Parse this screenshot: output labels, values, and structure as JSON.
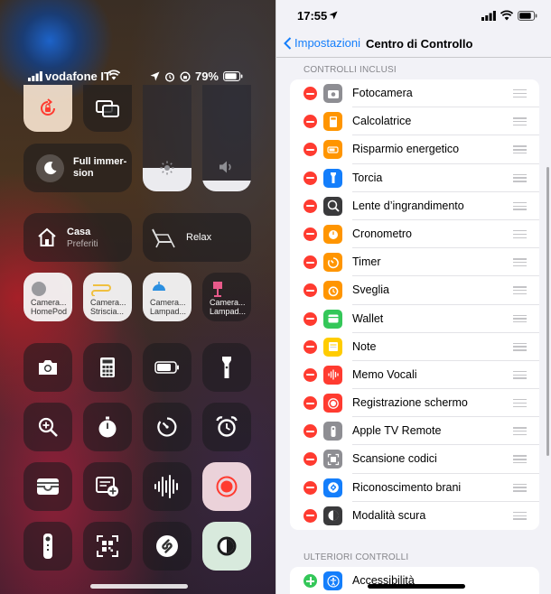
{
  "control_center": {
    "carrier": "vodafone IT",
    "battery_percent": "79%",
    "focus_label": "Full immer-\nsion",
    "home": {
      "title": "Casa",
      "subtitle": "Preferiti"
    },
    "scene_label": "Relax",
    "brightness_level": 0.22,
    "volume_level": 0.1,
    "cameras": [
      {
        "line1": "Camera...",
        "line2": "HomePod"
      },
      {
        "line1": "Camera...",
        "line2": "Striscia..."
      },
      {
        "line1": "Camera...",
        "line2": "Lampad..."
      },
      {
        "line1": "Camera...",
        "line2": "Lampad..."
      }
    ],
    "icons": [
      "rotation-lock-icon",
      "screen-mirroring-icon",
      "moon-icon",
      "home-icon",
      "relax-scene-icon",
      "homepod-icon",
      "led-strip-icon",
      "lamp-icon",
      "floor-lamp-icon",
      "camera-icon",
      "calculator-icon",
      "battery-icon",
      "flashlight-icon",
      "magnifier-icon",
      "stopwatch-icon",
      "timer-icon",
      "alarm-icon",
      "wallet-icon",
      "note-icon",
      "voice-memo-icon",
      "screen-record-icon",
      "tv-remote-icon",
      "qr-code-icon",
      "shazam-icon",
      "dark-mode-icon"
    ]
  },
  "settings": {
    "status_time": "17:55",
    "back_label": "Impostazioni",
    "title": "Centro di Controllo",
    "included_header": "CONTROLLI INCLUSI",
    "more_header": "ULTERIORI CONTROLLI",
    "included": [
      {
        "label": "Fotocamera",
        "color": "#8e8e93",
        "icon": "camera-icon"
      },
      {
        "label": "Calcolatrice",
        "color": "#ff9500",
        "icon": "calculator-icon"
      },
      {
        "label": "Risparmio energetico",
        "color": "#ff9500",
        "icon": "battery-icon"
      },
      {
        "label": "Torcia",
        "color": "#147efb",
        "icon": "flashlight-icon"
      },
      {
        "label": "Lente d’ingrandimento",
        "color": "#3a3a3c",
        "icon": "magnifier-icon"
      },
      {
        "label": "Cronometro",
        "color": "#ff9500",
        "icon": "stopwatch-icon"
      },
      {
        "label": "Timer",
        "color": "#ff9500",
        "icon": "timer-icon"
      },
      {
        "label": "Sveglia",
        "color": "#ff9500",
        "icon": "alarm-icon"
      },
      {
        "label": "Wallet",
        "color": "#34c759",
        "icon": "wallet-icon"
      },
      {
        "label": "Note",
        "color": "#ffcc00",
        "icon": "note-icon"
      },
      {
        "label": "Memo Vocali",
        "color": "#ff3b30",
        "icon": "voice-memo-icon"
      },
      {
        "label": "Registrazione schermo",
        "color": "#ff3b30",
        "icon": "screen-record-icon"
      },
      {
        "label": "Apple TV Remote",
        "color": "#8e8e93",
        "icon": "tv-remote-icon"
      },
      {
        "label": "Scansione codici",
        "color": "#8e8e93",
        "icon": "qr-code-icon"
      },
      {
        "label": "Riconoscimento brani",
        "color": "#147efb",
        "icon": "shazam-icon"
      },
      {
        "label": "Modalità scura",
        "color": "#3a3a3c",
        "icon": "dark-mode-icon"
      }
    ],
    "more": [
      {
        "label": "Accessibilità",
        "color": "#147efb",
        "icon": "accessibility-icon"
      }
    ]
  }
}
